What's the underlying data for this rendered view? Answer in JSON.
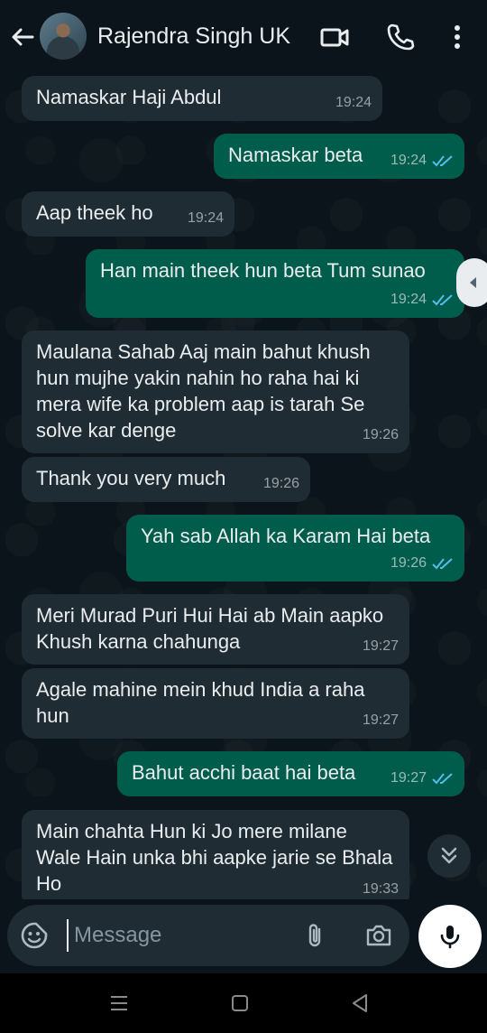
{
  "header": {
    "contact_name": "Rajendra Singh UK",
    "icons": [
      "back-arrow-icon",
      "avatar",
      "video-call-icon",
      "phone-icon",
      "more-options-icon"
    ]
  },
  "messages": [
    {
      "direction": "incoming",
      "text": "Namaskar Haji Abdul",
      "time": "19:24"
    },
    {
      "direction": "outgoing",
      "text": "Namaskar beta",
      "time": "19:24",
      "status": "read"
    },
    {
      "direction": "incoming",
      "text": "Aap theek ho",
      "time": "19:24"
    },
    {
      "direction": "outgoing",
      "text": "Han main theek hun beta Tum sunao",
      "time": "19:24",
      "status": "read"
    },
    {
      "direction": "incoming",
      "text": "Maulana Sahab Aaj main bahut khush hun mujhe yakin nahin ho raha hai ki mera wife ka problem aap is tarah Se solve kar denge",
      "time": "19:26"
    },
    {
      "direction": "incoming",
      "text": "Thank you very much",
      "time": "19:26"
    },
    {
      "direction": "outgoing",
      "text": "Yah sab Allah ka Karam Hai beta",
      "time": "19:26",
      "status": "read"
    },
    {
      "direction": "incoming",
      "text": "Meri Murad Puri Hui Hai ab Main aapko Khush karna chahunga",
      "time": "19:27"
    },
    {
      "direction": "incoming",
      "text": "Agale mahine mein khud India a raha hun",
      "time": "19:27"
    },
    {
      "direction": "outgoing",
      "text": "Bahut acchi baat hai beta",
      "time": "19:27",
      "status": "read"
    },
    {
      "direction": "incoming",
      "text": "Main chahta Hun ki Jo mere milane Wale Hain unka bhi aapke jarie se Bhala Ho",
      "time": "19:33"
    }
  ],
  "composer": {
    "placeholder": "Message",
    "icons": [
      "sticker-icon",
      "attach-icon",
      "camera-icon",
      "mic-icon"
    ]
  },
  "colors": {
    "background": "#0b141a",
    "incoming_bubble": "#202c33",
    "outgoing_bubble": "#005c4b",
    "read_ticks": "#53bdeb"
  }
}
